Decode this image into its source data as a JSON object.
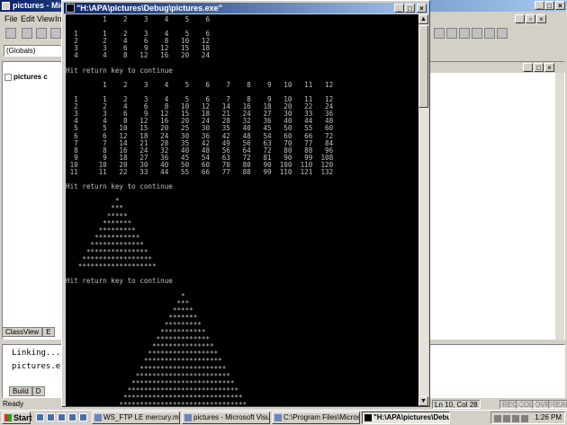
{
  "ide": {
    "title": "pictures - Microso",
    "menu": [
      "File",
      "Edit",
      "View",
      "In"
    ],
    "globals_combo": "(Globals)",
    "classview_root": "pictures c",
    "left_tabs": [
      "ClassView",
      "E"
    ],
    "output_lines": [
      "Linking...",
      "pictures.ex"
    ],
    "output_tabs": [
      "Build",
      "D"
    ],
    "status": {
      "ready": "Ready",
      "position": "Ln 10, Col 28",
      "indicators": [
        "REC",
        "COL",
        "OVR",
        "READ"
      ]
    }
  },
  "console": {
    "title": "\"H:\\APA\\pictures\\Debug\\pictures.exe\"",
    "lines": [
      "         1    2    3    4    5    6",
      "",
      "  1      1    2    3    4    5    6",
      "  2      2    4    6    8   10   12",
      "  3      3    6    9   12   15   18",
      "  4      4    8   12   16   20   24",
      "",
      "Hit return key to continue",
      "",
      "         1    2    3    4    5    6    7    8    9   10   11   12",
      "",
      "  1      1    2    3    4    5    6    7    8    9   10   11   12",
      "  2      2    4    6    8   10   12   14   16   18   20   22   24",
      "  3      3    6    9   12   15   18   21   24   27   30   33   36",
      "  4      4    8   12   16   20   24   28   32   36   40   44   48",
      "  5      5   10   15   20   25   30   35   40   45   50   55   60",
      "  6      6   12   18   24   30   36   42   48   54   60   66   72",
      "  7      7   14   21   28   35   42   49   56   63   70   77   84",
      "  8      8   16   24   32   40   48   56   64   72   80   88   96",
      "  9      9   18   27   36   45   54   63   72   81   90   99  108",
      " 10     10   20   30   40   50   60   70   80   90  100  110  120",
      " 11     11   22   33   44   55   66   77   88   99  110  121  132",
      "",
      "Hit return key to continue",
      "",
      "            *",
      "           ***",
      "          *****",
      "         *******",
      "        *********",
      "       ***********",
      "      *************",
      "     ***************",
      "    *****************",
      "   *******************",
      "",
      "Hit return key to continue",
      "",
      "                            *",
      "                           ***",
      "                          *****",
      "                         *******",
      "                        *********",
      "                       ***********",
      "                      *************",
      "                     ***************",
      "                    *****************",
      "                   *******************",
      "                  *********************",
      "                 ***********************",
      "                *************************",
      "               ***************************",
      "              *****************************",
      "             *******************************",
      "            *********************************",
      "           ***********************************",
      "          *************************************"
    ]
  },
  "taskbar": {
    "start": "Start",
    "tasks": [
      "WS_FTP LE mercury.mvh...",
      "pictures - Microsoft Visual...",
      "C:\\Program Files\\Microsof...",
      "\"H:\\APA\\pictures\\Debu..."
    ],
    "clock": "1:26 PM"
  }
}
